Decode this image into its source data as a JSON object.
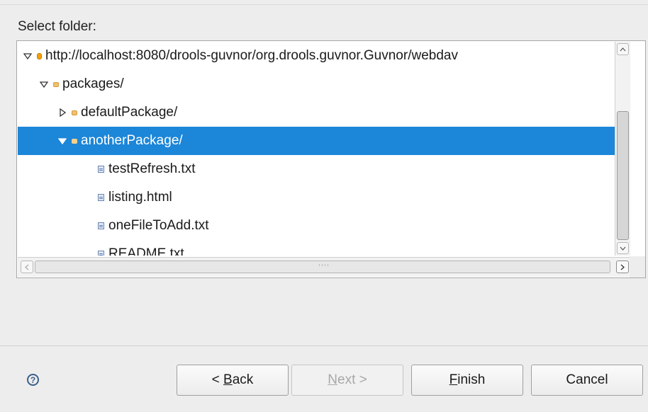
{
  "dialog": {
    "prompt": "Select folder:",
    "tree": {
      "rows": [
        {
          "label": "http://localhost:8080/drools-guvnor/org.drools.guvnor.Guvnor/webdav",
          "expanded": true,
          "type": "root"
        },
        {
          "label": "packages/",
          "expanded": true,
          "type": "folder"
        },
        {
          "label": "defaultPackage/",
          "expanded": false,
          "type": "folder"
        },
        {
          "label": "anotherPackage/",
          "expanded": true,
          "type": "folder",
          "selected": true
        },
        {
          "label": "testRefresh.txt",
          "type": "file"
        },
        {
          "label": "listing.html",
          "type": "file"
        },
        {
          "label": "oneFileToAdd.txt",
          "type": "file"
        },
        {
          "label": "README.txt",
          "type": "file"
        }
      ]
    },
    "buttons": {
      "back": {
        "pre": "< ",
        "mnemonic": "B",
        "post": "ack"
      },
      "next": {
        "mnemonic": "N",
        "post": "ext >"
      },
      "finish": {
        "mnemonic": "F",
        "post": "inish"
      },
      "cancel": "Cancel"
    },
    "help_symbol": "?",
    "colors": {
      "selection": "#1c86d8",
      "background": "#ededed"
    }
  }
}
